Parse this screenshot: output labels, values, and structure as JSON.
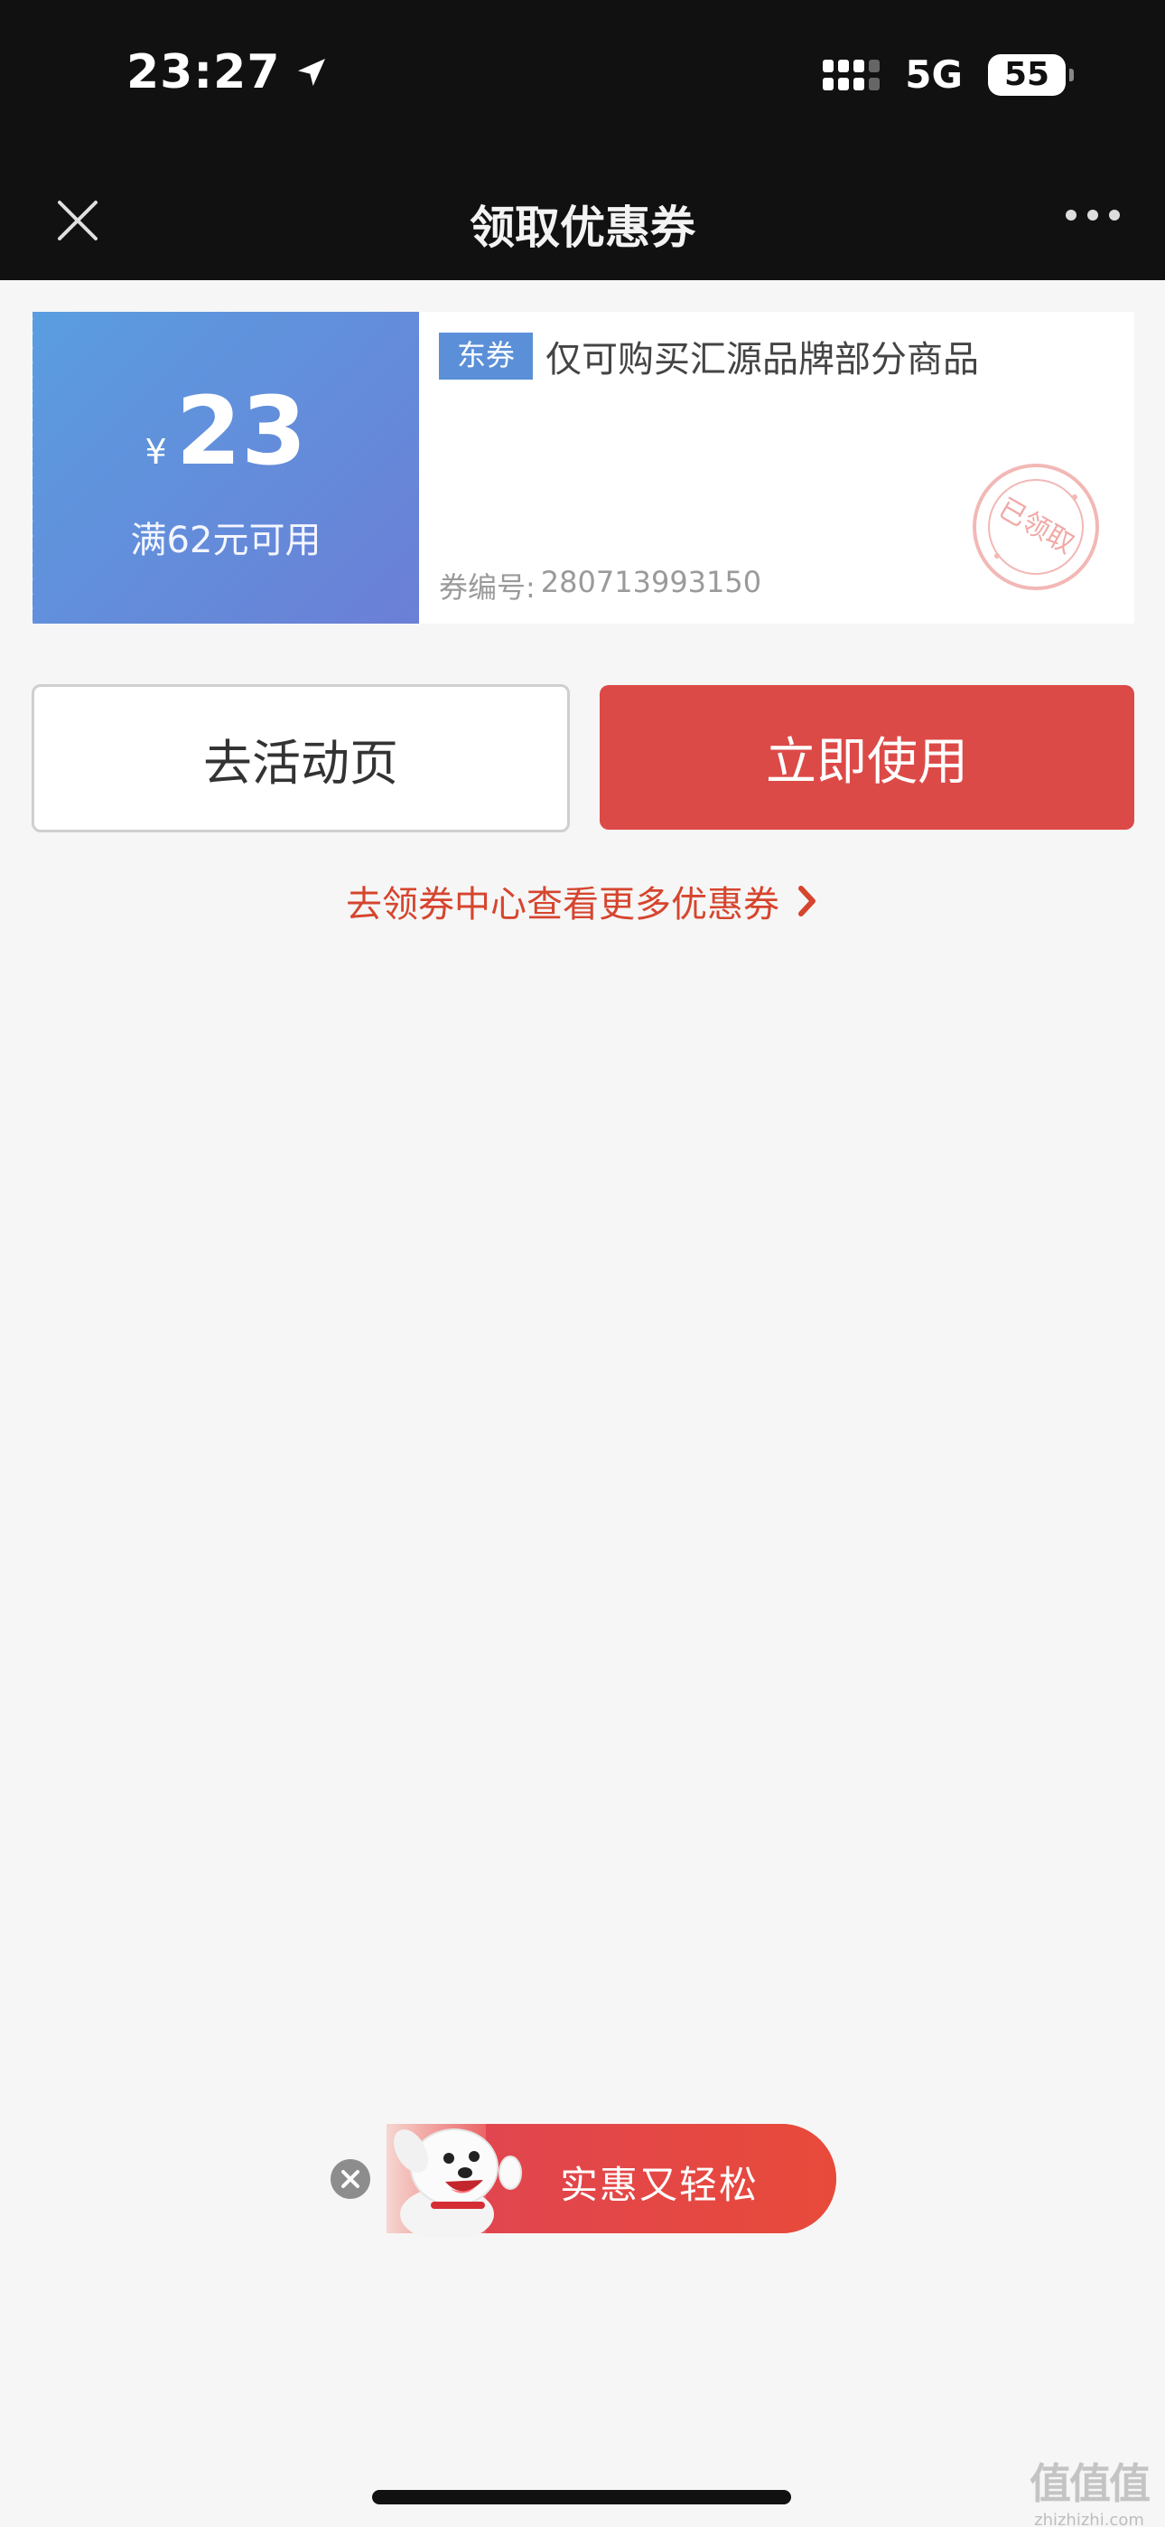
{
  "status_bar": {
    "time": "23:27",
    "network": "5G",
    "battery": "55"
  },
  "nav": {
    "title": "领取优惠券"
  },
  "coupon": {
    "currency": "¥",
    "amount": "23",
    "condition": "满62元可用",
    "tag": "东券",
    "description": "仅可购买汇源品牌部分商品",
    "code_label": "券编号:",
    "code": "280713993150",
    "stamp_text": "已领取",
    "accent_color": "#5b90d8"
  },
  "buttons": {
    "activity_label": "去活动页",
    "use_label": "立即使用",
    "use_color": "#dc4a48"
  },
  "center_link": "去领券中心查看更多优惠券",
  "promo": {
    "text": "实惠又轻松"
  },
  "watermark": {
    "main": "值值值",
    "sub": "zhizhizhi.com"
  }
}
